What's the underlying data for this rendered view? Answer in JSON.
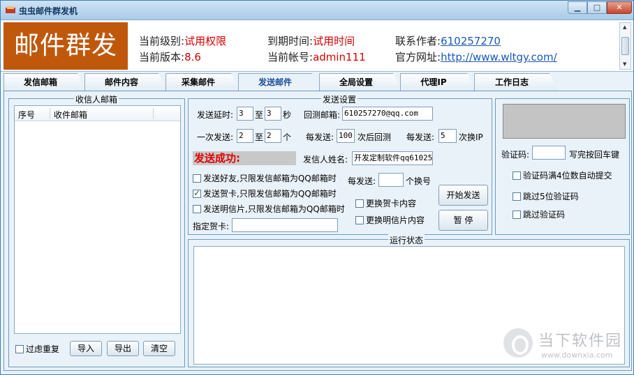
{
  "window": {
    "title": "虫虫邮件群发机",
    "controls": {
      "minimize": "▁",
      "maximize": "□",
      "close": "✕"
    }
  },
  "header": {
    "logo": "邮件群发",
    "level_label": "当前级别:",
    "level_value": "试用权限",
    "version_label": "当前版本:",
    "version_value": "8.6",
    "expire_label": "到期时间:",
    "expire_value": "试用时间",
    "account_label": "当前帐号:",
    "account_value": "admin111",
    "contact_label": "联系作者:",
    "contact_value": "610257270",
    "site_label": "官方网址:",
    "site_value": "http://www.wltgy.com/"
  },
  "tabs": [
    "发信邮箱",
    "邮件内容",
    "采集邮件",
    "发送邮件",
    "全局设置",
    "代理IP",
    "工作日志"
  ],
  "active_tab": 3,
  "recipients": {
    "group_title": "收信人邮箱",
    "col_index": "序号",
    "col_email": "收件邮箱",
    "filter_dup": "过虑重复",
    "import": "导入",
    "export": "导出",
    "clear": "清空"
  },
  "send_settings": {
    "group_title": "发送设置",
    "delay_label": "发送延时:",
    "delay_from": "3",
    "delay_to_label": "至",
    "delay_to": "3",
    "delay_unit": "秒",
    "reply_label": "回测邮箱:",
    "reply_value": "610257270@qq.com",
    "batch_label": "一次发送:",
    "batch_from": "2",
    "batch_to_label": "至",
    "batch_to": "2",
    "batch_unit": "个",
    "each_send_label": "每发送:",
    "each_send_value": "100",
    "each_send_suffix": "次后回测",
    "ip_send_label": "每发送:",
    "ip_send_value": "5",
    "ip_send_suffix": "次换IP",
    "status_text": "发送成功:",
    "sender_name_label": "发信人姓名:",
    "sender_name_value": "开发定制软件qq61025",
    "opt_friends": "发送好友,只限发信邮箱为QQ邮箱时",
    "opt_card": "发送贺卡,只限发信邮箱为QQ邮箱时",
    "opt_postcard": "发送明信片,只限发信邮箱为QQ邮箱时",
    "account_switch_label": "每发送:",
    "account_switch_value": "",
    "account_switch_suffix": "个换号",
    "change_card": "更换贺卡内容",
    "change_postcard": "更换明信片内容",
    "card_label": "指定贺卡:",
    "card_value": "",
    "start": "开始发送",
    "pause": "暂 停"
  },
  "captcha": {
    "label": "验证码:",
    "value": "",
    "hint": "写完按回车键",
    "auto_submit": "验证码满4位数自动提交",
    "skip5": "跳过5位验证码",
    "skip": "跳过验证码"
  },
  "log": {
    "group_title": "运行状态"
  },
  "watermark": {
    "name": "当下软件园",
    "url": "www.downxia.com"
  }
}
